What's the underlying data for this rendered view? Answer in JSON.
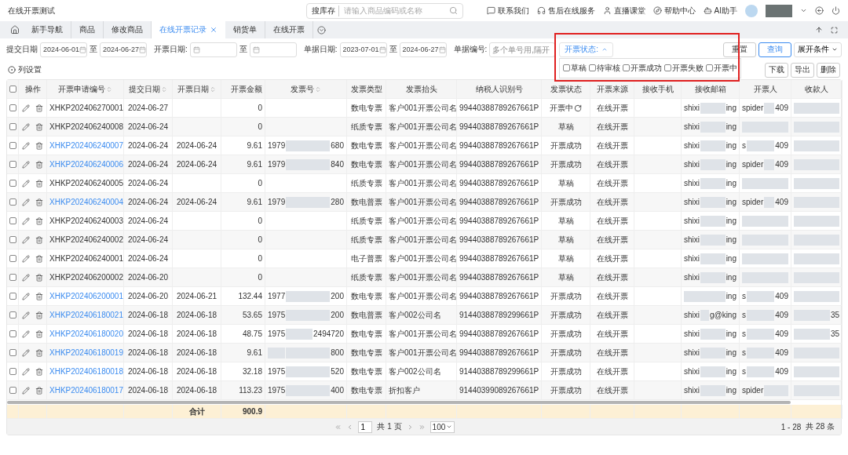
{
  "app_title": "在线开票测试",
  "search": {
    "label": "搜库存",
    "placeholder": "请输入商品编码或名称"
  },
  "top_links": [
    {
      "kind": "contact",
      "label": "联系我们"
    },
    {
      "kind": "service",
      "label": "售后在线服务"
    },
    {
      "kind": "live",
      "label": "直播课堂"
    },
    {
      "kind": "help",
      "label": "帮助中心"
    },
    {
      "kind": "ai",
      "label": "AI助手"
    }
  ],
  "tabs": [
    {
      "label": "新手导航",
      "selected": false,
      "closable": false
    },
    {
      "label": "商品",
      "selected": false,
      "closable": false
    },
    {
      "label": "修改商品",
      "selected": false,
      "closable": false
    },
    {
      "label": "在线开票记录",
      "selected": true,
      "closable": true
    },
    {
      "label": "销货单",
      "selected": false,
      "closable": false
    },
    {
      "label": "在线开票",
      "selected": false,
      "closable": false
    }
  ],
  "filters": [
    {
      "kind": "daterange",
      "label": "提交日期",
      "from": "2024-06-01",
      "sep": "至",
      "to": "2024-06-27"
    },
    {
      "kind": "daterange",
      "label": "开票日期:",
      "sep": "至"
    },
    {
      "kind": "daterange",
      "label": "单据日期:",
      "from": "2023-07-01",
      "sep": "至",
      "to": "2024-06-27"
    },
    {
      "kind": "text",
      "label": "单据编号:",
      "placeholder": "多个单号用,隔开"
    }
  ],
  "status_filter": {
    "label": "开票状态:",
    "expanded": true,
    "options": [
      {
        "label": "草稿",
        "checked": false
      },
      {
        "label": "待审核",
        "checked": false
      },
      {
        "label": "开票成功",
        "checked": false
      },
      {
        "label": "开票失败",
        "checked": false
      },
      {
        "label": "开票中",
        "checked": false
      }
    ]
  },
  "filter_buttons": [
    {
      "label": "重置",
      "primary": false
    },
    {
      "label": "查询",
      "primary": true
    }
  ],
  "expand_conditions": "展开条件",
  "column_settings": "列设置",
  "actions": [
    "下载",
    "导出",
    "删除"
  ],
  "select_all": {
    "checked": false
  },
  "columns": [
    {
      "label": "操作",
      "sortable": false
    },
    {
      "label": "开票申请编号",
      "sortable": true
    },
    {
      "label": "提交日期",
      "sortable": true
    },
    {
      "label": "开票日期",
      "sortable": true
    },
    {
      "label": "开票金额",
      "sortable": false
    },
    {
      "label": "发票号",
      "sortable": true
    },
    {
      "label": "发票类型",
      "sortable": false
    },
    {
      "label": "发票抬头",
      "sortable": false
    },
    {
      "label": "纳税人识别号",
      "sortable": false
    },
    {
      "label": "发票状态",
      "sortable": false
    },
    {
      "label": "开票来源",
      "sortable": false
    },
    {
      "label": "接收手机",
      "sortable": false
    },
    {
      "label": "接收邮箱",
      "sortable": false
    },
    {
      "label": "开票人",
      "sortable": false
    },
    {
      "label": "收款人",
      "sortable": false
    }
  ],
  "rows": [
    {
      "checked": false,
      "id": "XHKP202406270001",
      "link": false,
      "submitted": "2024-06-27",
      "amount": "0",
      "type": "数电专票",
      "title": "客户001开票公司名",
      "taxpayer": "99440388789267661P",
      "status": "开票中",
      "pending": true,
      "source": "在线开票",
      "email": {
        "start": "shixi",
        "end": "ing"
      },
      "drawer": {
        "start": "spider",
        "end": "409"
      }
    },
    {
      "checked": false,
      "id": "XHKP202406240008",
      "link": false,
      "submitted": "2024-06-24",
      "amount": "0",
      "type": "纸质专票",
      "title": "客户001开票公司名",
      "taxpayer": "99440388789267661P",
      "status": "草稿",
      "pending": false,
      "source": "在线开票",
      "email": {
        "start": "shixi",
        "end": "ing"
      },
      "drawer": {}
    },
    {
      "checked": false,
      "id": "XHKP202406240007",
      "link": true,
      "submitted": "2024-06-24",
      "invoiced": "2024-06-24",
      "amount": "9.61",
      "invoice_no": {
        "start": "1979",
        "end": "680"
      },
      "type": "数电专票",
      "title": "客户001开票公司名",
      "taxpayer": "99440388789267661P",
      "status": "开票成功",
      "pending": false,
      "source": "在线开票",
      "email": {
        "start": "shixi",
        "end": "ing"
      },
      "drawer": {
        "start": "s",
        "end": "409"
      }
    },
    {
      "checked": false,
      "id": "XHKP202406240006",
      "link": true,
      "submitted": "2024-06-24",
      "invoiced": "2024-06-24",
      "amount": "9.61",
      "invoice_no": {
        "start": "1979",
        "end": "840"
      },
      "type": "数电专票",
      "title": "客户001开票公司名",
      "taxpayer": "99440388789267661P",
      "status": "开票成功",
      "pending": false,
      "source": "在线开票",
      "email": {
        "start": "shixi",
        "end": "ing"
      },
      "drawer": {
        "start": "spider",
        "end": "409"
      }
    },
    {
      "checked": false,
      "id": "XHKP202406240005",
      "link": false,
      "submitted": "2024-06-24",
      "amount": "0",
      "type": "纸质专票",
      "title": "客户001开票公司名",
      "taxpayer": "99440388789267661P",
      "status": "草稿",
      "pending": false,
      "source": "在线开票",
      "email": {
        "start": "shixi",
        "end": "ing"
      },
      "drawer": {}
    },
    {
      "checked": false,
      "id": "XHKP202406240004",
      "link": true,
      "submitted": "2024-06-24",
      "invoiced": "2024-06-24",
      "amount": "9.61",
      "invoice_no": {
        "start": "1979",
        "end": "280"
      },
      "type": "数电普票",
      "title": "客户001开票公司名",
      "taxpayer": "99440388789267661P",
      "status": "开票成功",
      "pending": false,
      "source": "在线开票",
      "email": {
        "start": "shixi",
        "end": "ing"
      },
      "drawer": {
        "start": "spider",
        "end": "409"
      }
    },
    {
      "checked": false,
      "id": "XHKP202406240003",
      "link": false,
      "submitted": "2024-06-24",
      "amount": "0",
      "type": "纸质专票",
      "title": "客户001开票公司名",
      "taxpayer": "99440388789267661P",
      "status": "草稿",
      "pending": false,
      "source": "在线开票",
      "email": {
        "start": "shixi",
        "end": "ing"
      },
      "drawer": {}
    },
    {
      "checked": false,
      "id": "XHKP202406240002",
      "link": false,
      "submitted": "2024-06-24",
      "amount": "0",
      "type": "纸质专票",
      "title": "客户001开票公司名",
      "taxpayer": "99440388789267661P",
      "status": "草稿",
      "pending": false,
      "source": "在线开票",
      "email": {
        "start": "shixi",
        "end": "ing"
      },
      "drawer": {}
    },
    {
      "checked": false,
      "id": "XHKP202406240001",
      "link": false,
      "submitted": "2024-06-24",
      "amount": "0",
      "type": "电子普票",
      "title": "客户001开票公司名",
      "taxpayer": "99440388789267661P",
      "status": "草稿",
      "pending": false,
      "source": "在线开票",
      "email": {
        "start": "shixi",
        "end": "ing"
      },
      "drawer": {}
    },
    {
      "checked": false,
      "id": "XHKP202406200002",
      "link": false,
      "submitted": "2024-06-20",
      "amount": "0",
      "type": "纸质专票",
      "title": "客户001开票公司名",
      "taxpayer": "99440388789267661P",
      "status": "草稿",
      "pending": false,
      "source": "在线开票",
      "email": {
        "start": "shixi",
        "end": "ing"
      },
      "drawer": {}
    },
    {
      "checked": false,
      "id": "XHKP202406200001",
      "link": true,
      "submitted": "2024-06-20",
      "invoiced": "2024-06-21",
      "amount": "132.44",
      "invoice_no": {
        "start": "1977",
        "end": "200"
      },
      "type": "数电专票",
      "title": "客户001开票公司名",
      "taxpayer": "99440388789267661P",
      "status": "开票成功",
      "pending": false,
      "source": "在线开票",
      "email": {
        "end": "ing"
      },
      "drawer": {
        "start": "s",
        "end": "409"
      }
    },
    {
      "checked": false,
      "id": "XHKP202406180021",
      "link": true,
      "submitted": "2024-06-18",
      "invoiced": "2024-06-18",
      "amount": "53.65",
      "invoice_no": {
        "start": "1975",
        "end": "200"
      },
      "type": "数电普票",
      "title": "客户002公司名",
      "taxpayer": "91440388789299661P",
      "status": "开票成功",
      "pending": false,
      "source": "在线开票",
      "email": {
        "start": "shixi",
        "end": "g@king"
      },
      "drawer": {
        "start": "s",
        "end": "409"
      },
      "payee": "35"
    },
    {
      "checked": false,
      "id": "XHKP202406180020",
      "link": true,
      "submitted": "2024-06-18",
      "invoiced": "2024-06-18",
      "amount": "48.75",
      "invoice_no": {
        "start": "1975",
        "end": "2494720"
      },
      "type": "数电专票",
      "title": "客户001开票公司名",
      "taxpayer": "99440388789267661P",
      "status": "开票成功",
      "pending": false,
      "source": "在线开票",
      "email": {
        "start": "shixi",
        "end": "ing"
      },
      "drawer": {
        "start": "s",
        "end": "409"
      },
      "payee": "35"
    },
    {
      "checked": false,
      "id": "XHKP202406180019",
      "link": true,
      "submitted": "2024-06-18",
      "invoiced": "2024-06-18",
      "amount": "9.61",
      "invoice_no": {
        "end": "800"
      },
      "type": "数电专票",
      "title": "客户001开票公司名",
      "taxpayer": "99440388789267661P",
      "status": "开票成功",
      "pending": false,
      "source": "在线开票",
      "email": {
        "start": "shixi",
        "end": "ing"
      },
      "drawer": {
        "start": "s",
        "end": "409"
      }
    },
    {
      "checked": false,
      "id": "XHKP202406180018",
      "link": true,
      "submitted": "2024-06-18",
      "invoiced": "2024-06-18",
      "amount": "32.18",
      "invoice_no": {
        "start": "1975",
        "end": "520"
      },
      "type": "数电专票",
      "title": "客户002公司名",
      "taxpayer": "91440388789299661P",
      "status": "开票成功",
      "pending": false,
      "source": "在线开票",
      "email": {
        "start": "shixi",
        "end": "ing"
      },
      "drawer": {
        "start": "s",
        "end": "409"
      }
    },
    {
      "checked": false,
      "id": "XHKP202406180017",
      "link": true,
      "submitted": "2024-06-18",
      "invoiced": "2024-06-18",
      "amount": "113.23",
      "invoice_no": {
        "start": "1975",
        "end": "400"
      },
      "type": "数电专票",
      "title": "折扣客户",
      "taxpayer": "91440399089267661P",
      "status": "开票成功",
      "pending": false,
      "source": "在线开票",
      "email": {
        "start": "shixi",
        "end": "ing"
      },
      "drawer": {
        "start": "spider"
      }
    }
  ],
  "totals": {
    "label": "合计",
    "amount": "900.9"
  },
  "pagination": {
    "page": "1",
    "pages": "共 1 页",
    "page_size": "100",
    "range": "1 - 28",
    "total": "共 28 条"
  }
}
